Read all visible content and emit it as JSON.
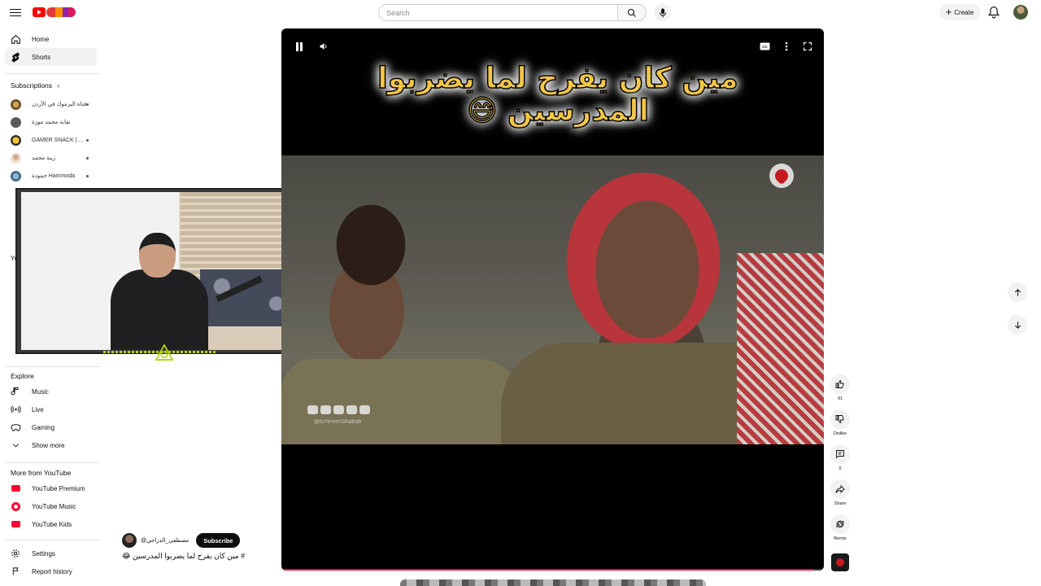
{
  "header": {
    "search_placeholder": "Search",
    "create_label": "Create"
  },
  "sidebar": {
    "home": "Home",
    "shorts": "Shorts",
    "subscriptions_title": "Subscriptions",
    "subscriptions": [
      "قناة اليرموك في الأردن",
      "نقابة محمد موزة",
      "GAMER SNACK | ...",
      "زينة محمد",
      "حمودة Hammoda"
    ],
    "you_title": "Yo",
    "explore_title": "Explore",
    "explore": [
      "Music",
      "Live",
      "Gaming",
      "Show more"
    ],
    "more_title": "More from YouTube",
    "more": [
      "YouTube Premium",
      "YouTube Music",
      "YouTube Kids"
    ],
    "settings": "Settings",
    "report_history": "Report history"
  },
  "video": {
    "caption_line1": "مين كان يفرح لما يضربوا",
    "caption_line2": "المدرسين 😅",
    "watermark_handle": "@tvYemenShabab",
    "progress_fraction": 0.98
  },
  "actions": {
    "likes": "91",
    "dislike": "Dislike",
    "comments": "5",
    "share": "Share",
    "remix": "Remix"
  },
  "short_info": {
    "channel": "@مصطفى_الدراجي",
    "subscribe": "Subscribe",
    "title": "# مين كان يفرح لما يضربوا المدرسين 😂"
  },
  "colors": {
    "accent_red": "#ff0000",
    "caption_yellow": "#f3c648"
  }
}
